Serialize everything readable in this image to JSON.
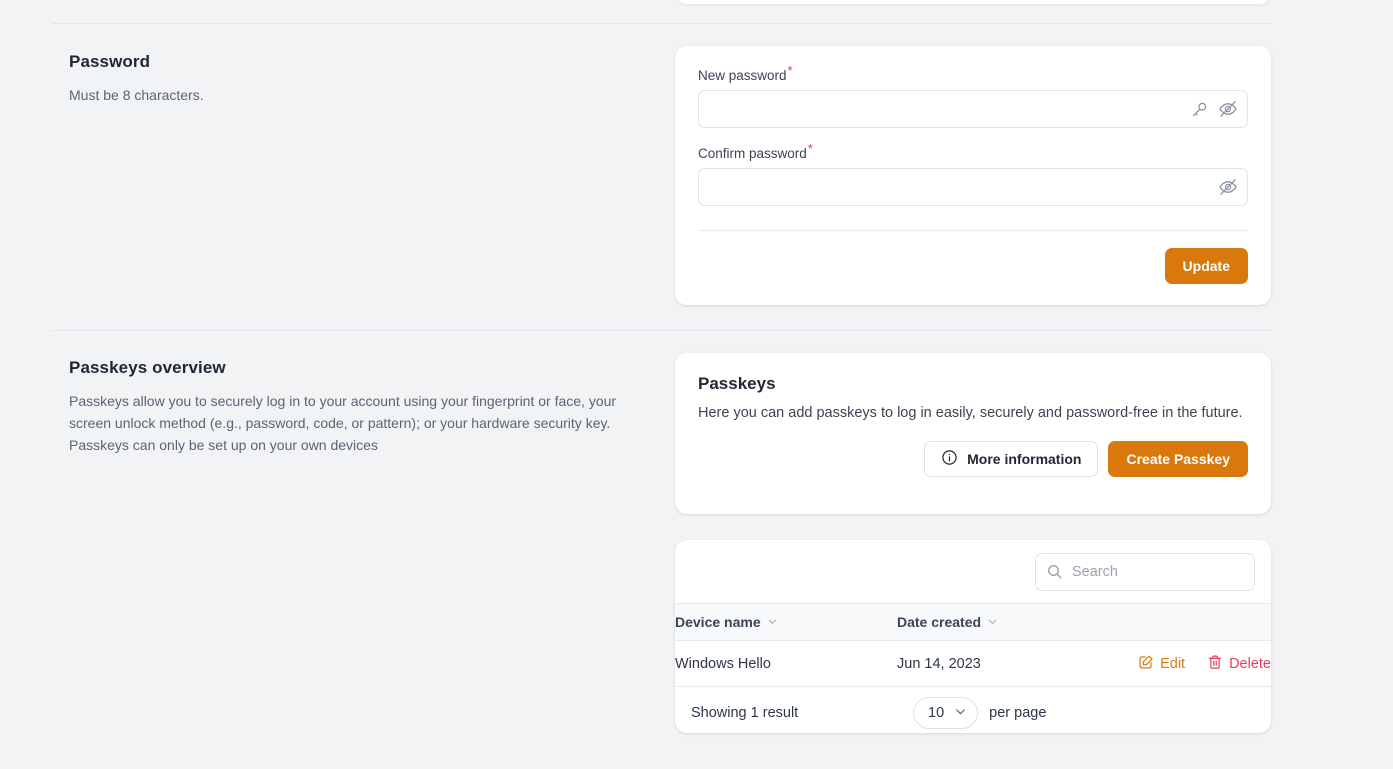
{
  "password_section": {
    "title": "Password",
    "description": "Must be 8 characters.",
    "new_password": {
      "label": "New password",
      "required_marker": "*",
      "value": "",
      "placeholder": ""
    },
    "confirm_password": {
      "label": "Confirm password",
      "required_marker": "*",
      "value": "",
      "placeholder": ""
    },
    "update_button": "Update",
    "icons": {
      "generate_key": "key-icon",
      "toggle_visibility": "eye-off-icon"
    }
  },
  "passkeys_overview": {
    "title": "Passkeys overview",
    "description": "Passkeys allow you to securely log in to your account using your fingerprint or face, your screen unlock method (e.g., password, code, or pattern); or your hardware security key. Passkeys can only be set up on your own devices"
  },
  "passkeys_card": {
    "title": "Passkeys",
    "description": "Here you can add passkeys to log in easily, securely and password-free in the future.",
    "more_information_button": "More information",
    "more_information_icon": "info-circle-icon",
    "create_passkey_button": "Create Passkey"
  },
  "passkeys_table": {
    "search": {
      "placeholder": "Search",
      "value": "",
      "icon": "search-icon"
    },
    "columns": [
      {
        "label": "Device name",
        "sort_icon": "chevron-down-icon"
      },
      {
        "label": "Date created",
        "sort_icon": "chevron-down-icon"
      }
    ],
    "rows": [
      {
        "device_name": "Windows Hello",
        "date_created": "Jun 14, 2023",
        "edit_label": "Edit",
        "edit_icon": "pencil-square-icon",
        "delete_label": "Delete",
        "delete_icon": "trash-icon"
      }
    ],
    "footer": {
      "showing": "Showing 1 result",
      "per_page_value": "10",
      "per_page_label": "per page",
      "per_page_icon": "chevron-down-icon"
    }
  },
  "colors": {
    "accent_orange": "#d9780c",
    "danger_pink": "#ea3a5f",
    "required_star": "#c9415c",
    "page_background": "#f2f3f5",
    "card_background": "#ffffff",
    "border": "#dfe2e7"
  }
}
